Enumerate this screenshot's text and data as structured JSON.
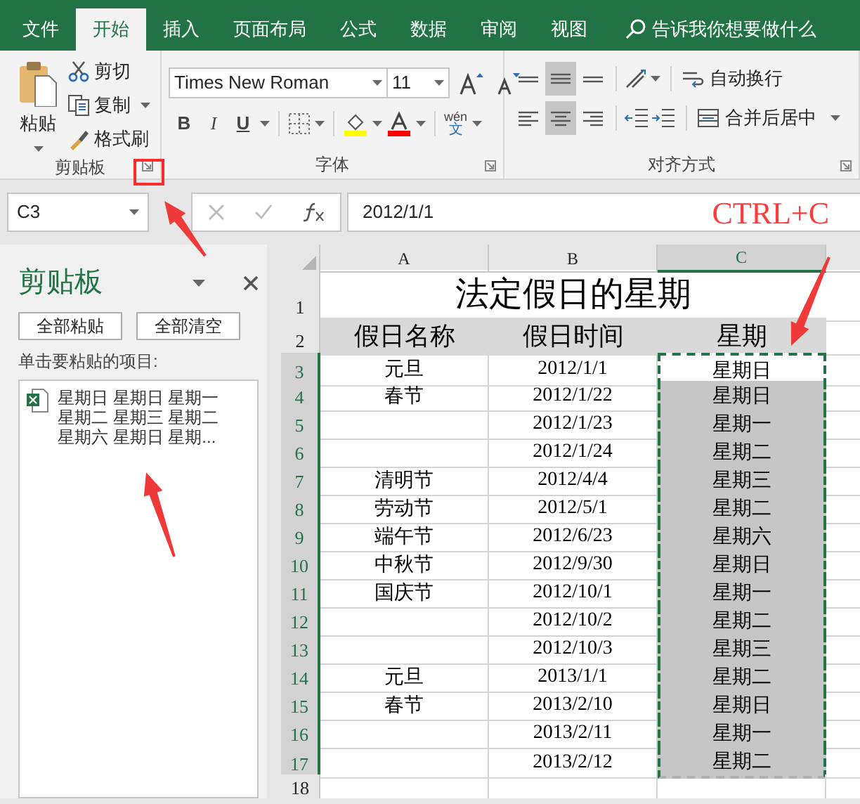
{
  "tabs": [
    {
      "label": "文件",
      "selected": false
    },
    {
      "label": "开始",
      "selected": true
    },
    {
      "label": "插入",
      "selected": false
    },
    {
      "label": "页面布局",
      "selected": false
    },
    {
      "label": "公式",
      "selected": false
    },
    {
      "label": "数据",
      "selected": false
    },
    {
      "label": "审阅",
      "selected": false
    },
    {
      "label": "视图",
      "selected": false
    }
  ],
  "tell_me": "告诉我你想要做什么",
  "ribbon": {
    "clipboard": {
      "label": "剪贴板",
      "paste": "粘贴",
      "cut": "剪切",
      "copy": "复制",
      "format_painter": "格式刷"
    },
    "font": {
      "label": "字体",
      "font_name": "Times New Roman",
      "font_size": "11",
      "bold": "B",
      "italic": "I",
      "underline": "U",
      "phonetic": "wén",
      "phonetic_char": "文"
    },
    "alignment": {
      "label": "对齐方式",
      "vertical": [
        {
          "selected": false
        },
        {
          "selected": true
        },
        {
          "selected": false
        }
      ],
      "horizontal": [
        {
          "selected": false
        },
        {
          "selected": true
        },
        {
          "selected": false
        }
      ],
      "wrap_text": "自动换行",
      "merge_center": "合并后居中"
    }
  },
  "formula_bar": {
    "name_box": "C3",
    "formula": "2012/1/1"
  },
  "annotation": "CTRL+C",
  "clipboard_pane": {
    "title": "剪贴板",
    "buttons": [
      "全部粘贴",
      "全部清空"
    ],
    "instruction": "单击要粘贴的项目:",
    "items": [
      {
        "lines": [
          "星期日 星期日 星期一",
          "星期二 星期三 星期二",
          "星期六 星期日 星期..."
        ]
      }
    ]
  },
  "sheet": {
    "columns": [
      {
        "label": "A",
        "selected": false
      },
      {
        "label": "B",
        "selected": false
      },
      {
        "label": "C",
        "selected": true
      }
    ],
    "title": {
      "row": "1",
      "text": "法定假日的星期"
    },
    "header": {
      "row": "2",
      "cells": [
        "假日名称",
        "假日时间",
        "星期"
      ]
    },
    "rows": [
      {
        "row": "3",
        "name": "元旦",
        "date": "2012/1/1",
        "weekday": "星期日",
        "selected": true,
        "active": true
      },
      {
        "row": "4",
        "name": "春节",
        "date": "2012/1/22",
        "weekday": "星期日",
        "selected": true,
        "active": false
      },
      {
        "row": "5",
        "date": "2012/1/23",
        "weekday": "星期一",
        "selected": true,
        "active": false
      },
      {
        "row": "6",
        "date": "2012/1/24",
        "weekday": "星期二",
        "selected": true,
        "active": false
      },
      {
        "row": "7",
        "name": "清明节",
        "date": "2012/4/4",
        "weekday": "星期三",
        "selected": true,
        "active": false
      },
      {
        "row": "8",
        "name": "劳动节",
        "date": "2012/5/1",
        "weekday": "星期二",
        "selected": true,
        "active": false
      },
      {
        "row": "9",
        "name": "端午节",
        "date": "2012/6/23",
        "weekday": "星期六",
        "selected": true,
        "active": false
      },
      {
        "row": "10",
        "name": "中秋节",
        "date": "2012/9/30",
        "weekday": "星期日",
        "selected": true,
        "active": false
      },
      {
        "row": "11",
        "name": "国庆节",
        "date": "2012/10/1",
        "weekday": "星期一",
        "selected": true,
        "active": false
      },
      {
        "row": "12",
        "date": "2012/10/2",
        "weekday": "星期二",
        "selected": true,
        "active": false
      },
      {
        "row": "13",
        "date": "2012/10/3",
        "weekday": "星期三",
        "selected": true,
        "active": false
      },
      {
        "row": "14",
        "name": "元旦",
        "date": "2013/1/1",
        "weekday": "星期二",
        "selected": true,
        "active": false
      },
      {
        "row": "15",
        "name": "春节",
        "date": "2013/2/10",
        "weekday": "星期日",
        "selected": true,
        "active": false
      },
      {
        "row": "16",
        "date": "2013/2/11",
        "weekday": "星期一",
        "selected": true,
        "active": false
      },
      {
        "row": "17",
        "date": "2013/2/12",
        "weekday": "星期二",
        "selected": true,
        "active": false
      },
      {
        "row": "18",
        "selected": false
      }
    ]
  }
}
